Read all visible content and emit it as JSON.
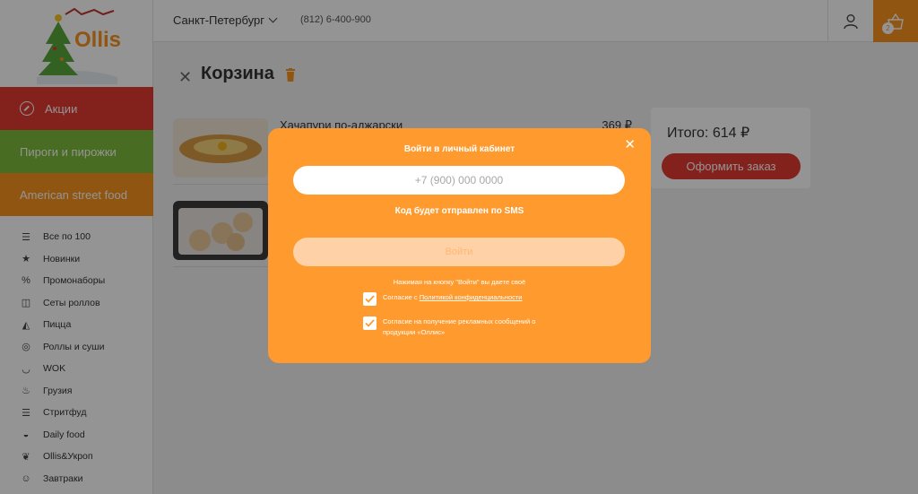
{
  "sidebar": {
    "logo_text": "Ollis",
    "promos": [
      {
        "label": "Акции"
      },
      {
        "label": "Пироги и пирожки"
      },
      {
        "label": "American street food"
      }
    ],
    "menu": [
      {
        "label": "Все по 100",
        "icon": "list-icon"
      },
      {
        "label": "Новинки",
        "icon": "star-icon"
      },
      {
        "label": "Промонаборы",
        "icon": "percent-icon"
      },
      {
        "label": "Сеты роллов",
        "icon": "sets-icon"
      },
      {
        "label": "Пицца",
        "icon": "pizza-icon"
      },
      {
        "label": "Роллы и суши",
        "icon": "sushi-icon"
      },
      {
        "label": "WOK",
        "icon": "wok-icon"
      },
      {
        "label": "Грузия",
        "icon": "georgia-icon"
      },
      {
        "label": "Стритфуд",
        "icon": "burger-icon"
      },
      {
        "label": "Daily food",
        "icon": "bowl-icon"
      },
      {
        "label": "Ollis&Укроп",
        "icon": "leaf-icon"
      },
      {
        "label": "Завтраки",
        "icon": "breakfast-icon"
      }
    ]
  },
  "header": {
    "city": "Санкт-Петербург",
    "phone": "(812) 6-400-900",
    "cart_count": "2"
  },
  "cart": {
    "title": "Корзина",
    "items": [
      {
        "name": "Хачапури по-аджарски",
        "price": "369 ₽"
      },
      {
        "name": "",
        "price": ""
      }
    ],
    "total": "Итого: 614 ₽",
    "order_button": "Оформить заказ"
  },
  "modal": {
    "title": "Войти в личный кабинет",
    "close": "✕",
    "phone_placeholder": "+7 (900) 000 0000",
    "sms_note": "Код будет отправлен по SMS",
    "login_button": "Войти",
    "agree_note": "Нажимая на кнопку \"Войти\" вы даете своё",
    "privacy_prefix": "Согласие с ",
    "privacy_link": "Политикой конфиденциальности",
    "ads_consent": "Согласие на получение рекламных сообщений о продукции «Оллис»"
  },
  "colors": {
    "accent_orange": "#ff9a2e",
    "promo_red": "#e23a33",
    "promo_green": "#7dba3a",
    "promo_orange": "#f7931e"
  }
}
